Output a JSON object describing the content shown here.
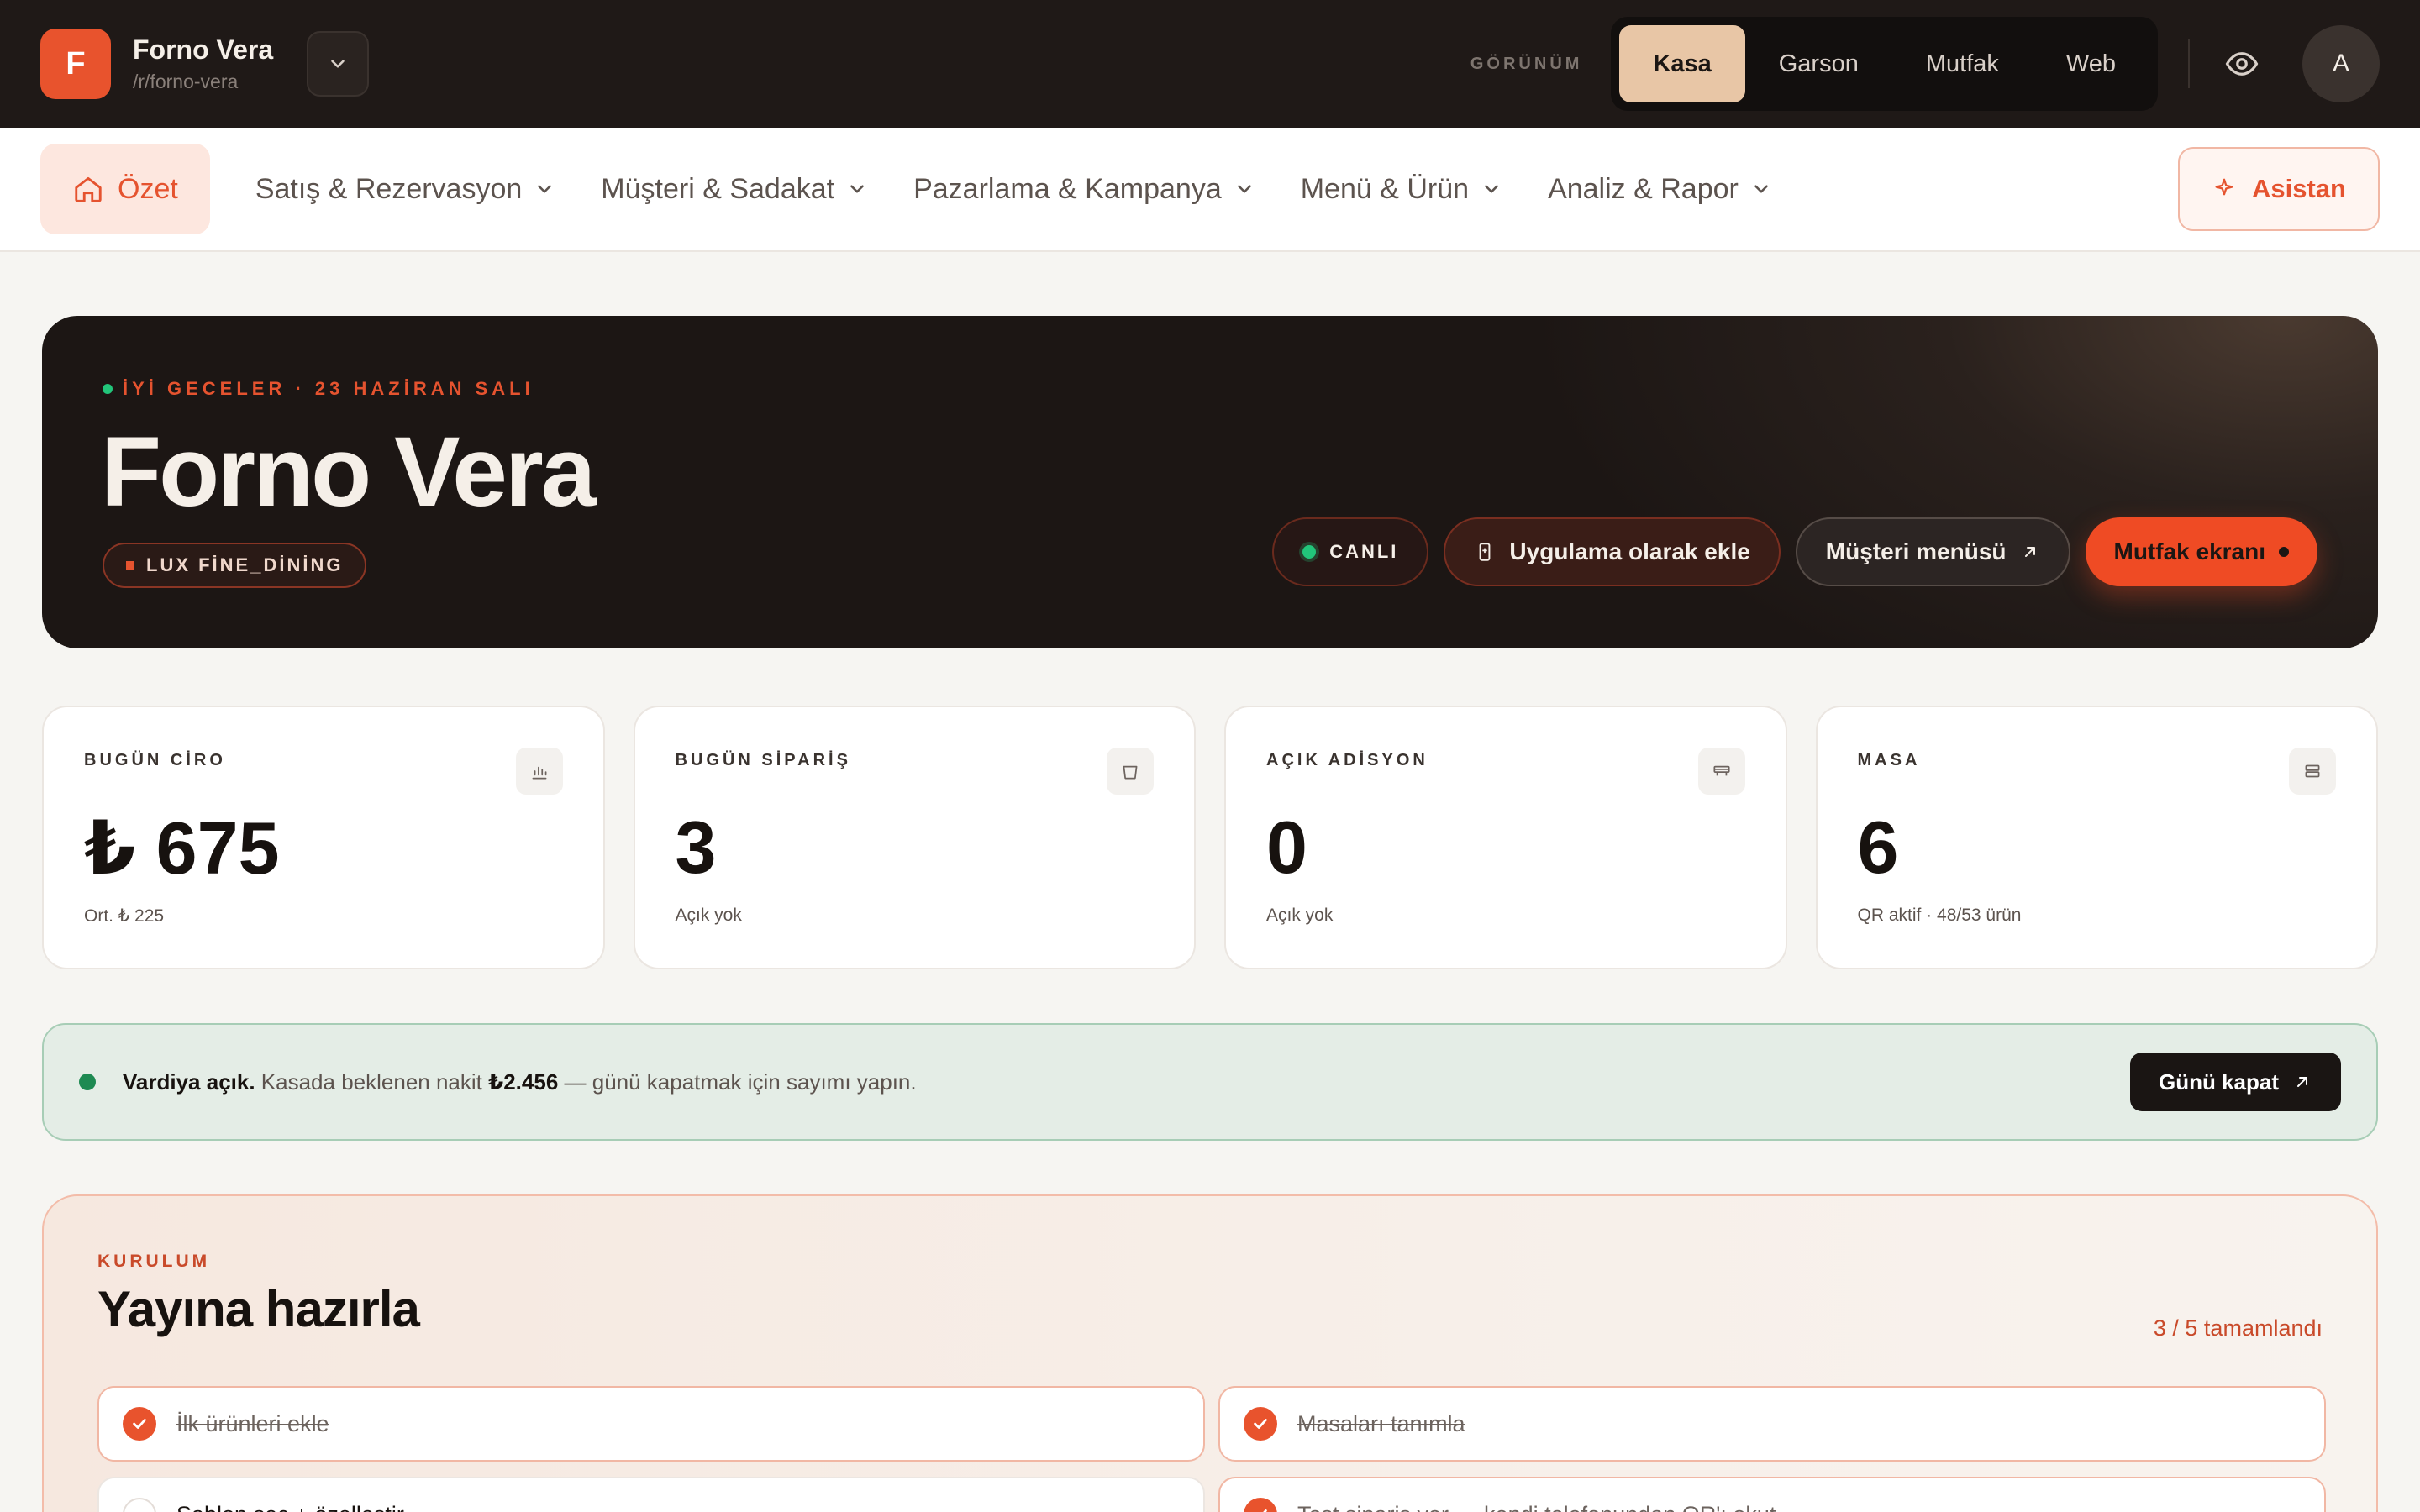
{
  "topbar": {
    "logo_letter": "F",
    "brand_name": "Forno Vera",
    "brand_slug": "/r/forno-vera",
    "view_label": "GÖRÜNÜM",
    "views": [
      "Kasa",
      "Garson",
      "Mutfak",
      "Web"
    ],
    "active_view": "Kasa",
    "avatar_letter": "A"
  },
  "nav": {
    "home_label": "Özet",
    "items": [
      {
        "label": "Satış & Rezervasyon"
      },
      {
        "label": "Müşteri & Sadakat"
      },
      {
        "label": "Pazarlama & Kampanya"
      },
      {
        "label": "Menü & Ürün"
      },
      {
        "label": "Analiz & Rapor"
      }
    ],
    "assistant_label": "Asistan"
  },
  "hero": {
    "greeting": "İYİ GECELER · 23 HAZİRAN SALI",
    "title": "Forno Vera",
    "tag": "LUX FİNE_DİNİNG",
    "live_label": "CANLI",
    "app_label": "Uygulama olarak ekle",
    "menu_label": "Müşteri menüsü",
    "kitchen_label": "Mutfak ekranı"
  },
  "stats": [
    {
      "label": "BUGÜN CİRO",
      "value": "₺ 675",
      "sub": "Ort. ₺ 225",
      "icon": "bar-chart-icon"
    },
    {
      "label": "BUGÜN SİPARİŞ",
      "value": "3",
      "sub": "Açık yok",
      "icon": "bag-icon"
    },
    {
      "label": "AÇIK ADİSYON",
      "value": "0",
      "sub": "Açık yok",
      "icon": "receipt-icon"
    },
    {
      "label": "MASA",
      "value": "6",
      "sub": "QR aktif · 48/53 ürün",
      "icon": "table-icon"
    }
  ],
  "shift": {
    "title": "Vardiya açık.",
    "text_before": "Kasada beklenen nakit",
    "amount": "₺2.456",
    "text_after": "— günü kapatmak için sayımı yapın.",
    "button": "Günü kapat"
  },
  "setup": {
    "eyebrow": "KURULUM",
    "title": "Yayına hazırla",
    "progress": "3 / 5 tamamlandı",
    "tasks": [
      {
        "label": "İlk ürünleri ekle",
        "done": true
      },
      {
        "label": "Masaları tanımla",
        "done": true
      },
      {
        "label": "Şablon seç + özelleştir",
        "done": false
      },
      {
        "label": "Test sipariş ver — kendi telefonundan QR'ı okut",
        "done": true
      }
    ]
  },
  "colors": {
    "accent": "#e8532d",
    "topbar_bg": "#1f1917",
    "active_view_bg": "#e8c6a6",
    "shift_bg": "#e4ede6",
    "live_dot": "#22c57a"
  }
}
